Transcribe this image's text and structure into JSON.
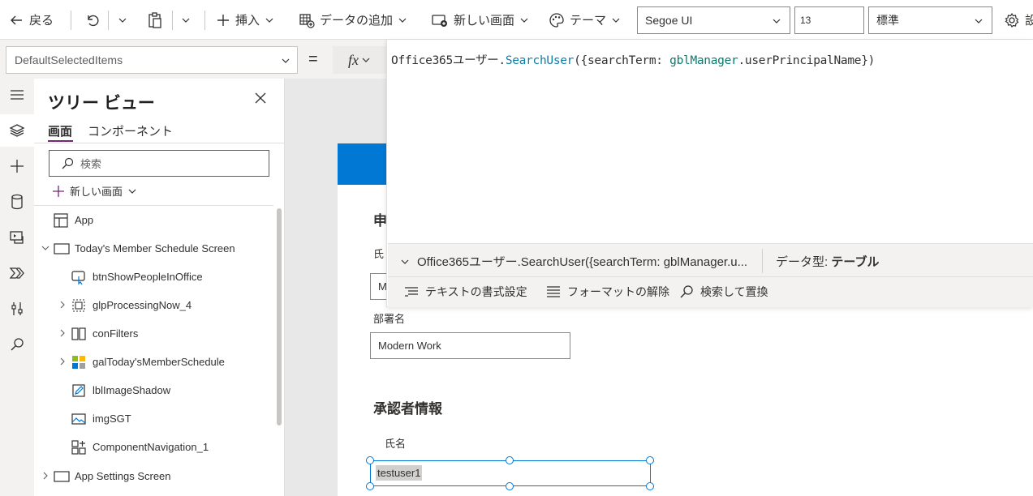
{
  "toolbar": {
    "back_label": "戻る",
    "insert_label": "挿入",
    "add_data_label": "データの追加",
    "new_screen_label": "新しい画面",
    "theme_label": "テーマ",
    "font_family": "Segoe UI",
    "font_size": "13",
    "font_weight": "標準",
    "settings_label": "設"
  },
  "formula_bar": {
    "property": "DefaultSelectedItems",
    "equals": "=",
    "fx_label": "fx",
    "code": {
      "p1": "Office365ユーザー.",
      "fn": "SearchUser",
      "p2": "({searchTerm: ",
      "ident": "gblManager",
      "p3": ".userPrincipalName})"
    },
    "result_expression": "Office365ユーザー.SearchUser({searchTerm: gblManager.u...",
    "data_type_label": "データ型:",
    "data_type_value": "テーブル",
    "format_text_label": "テキストの書式設定",
    "remove_format_label": "フォーマットの解除",
    "find_replace_label": "検索して置換"
  },
  "tree_view": {
    "title": "ツリー ビュー",
    "tab_screens": "画面",
    "tab_components": "コンポーネント",
    "search_placeholder": "検索",
    "new_screen_label": "新しい画面",
    "items": [
      {
        "label": "App"
      },
      {
        "label": "Today's Member Schedule Screen"
      },
      {
        "label": "btnShowPeopleInOffice"
      },
      {
        "label": "glpProcessingNow_4"
      },
      {
        "label": "conFilters"
      },
      {
        "label": "galToday'sMemberSchedule"
      },
      {
        "label": "lblImageShadow"
      },
      {
        "label": "imgSGT"
      },
      {
        "label": "ComponentNavigation_1"
      },
      {
        "label": "App Settings Screen"
      }
    ]
  },
  "canvas": {
    "section_partial_heading": "申",
    "name_label_partial": "氏",
    "name_value_partial": "M",
    "department_label": "部署名",
    "department_value": "Modern Work",
    "approver_heading": "承認者情報",
    "approver_name_label": "氏名",
    "approver_name_value": "testuser1"
  },
  "colors": {
    "accent": "#742774",
    "selection": "#0078d4",
    "function": "#0e7fa6",
    "identifier": "#0b7a6e"
  }
}
